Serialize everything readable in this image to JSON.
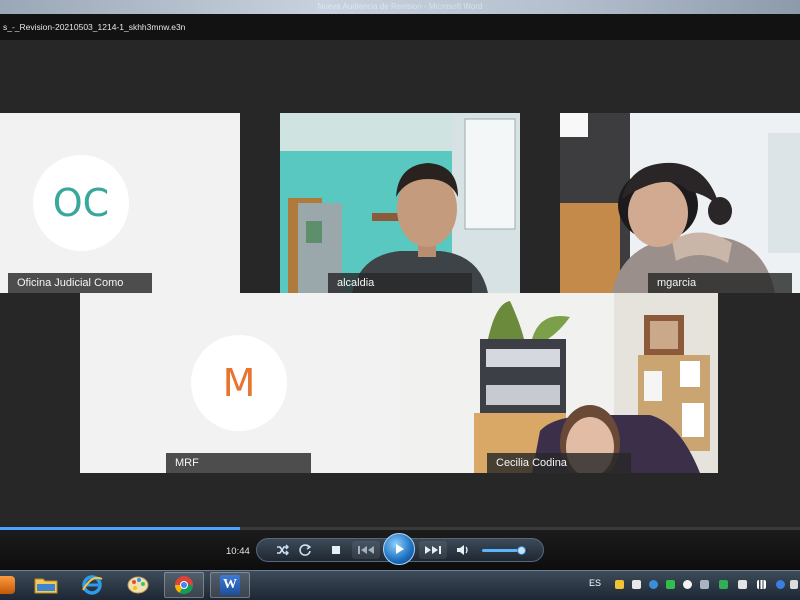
{
  "window": {
    "title": "Nueva Audiencia de Revision - Microsoft Word",
    "file_name": "s_-_Revision-20210503_1214-1_skhh3mnw.e3n"
  },
  "participants": [
    {
      "name": "Oficina Judicial Como",
      "initials": "OC",
      "initials_color": "#3aa79d",
      "type": "avatar"
    },
    {
      "name": "alcaldia",
      "type": "video"
    },
    {
      "name": "mgarcia",
      "type": "video"
    },
    {
      "name": "MRF",
      "initials": "M",
      "initials_color": "#e8752f",
      "type": "avatar"
    },
    {
      "name": "Cecilia Codina",
      "type": "video"
    }
  ],
  "player": {
    "time": "10:44",
    "progress": 0.3,
    "volume": 0.85,
    "icons": [
      "shuffle-icon",
      "repeat-icon",
      "stop-icon",
      "previous-icon",
      "play-icon",
      "next-icon",
      "volume-icon"
    ]
  },
  "taskbar": {
    "apps": [
      "media-player-icon",
      "folder-icon",
      "internet-explorer-icon",
      "paint-icon",
      "chrome-icon",
      "word-icon"
    ],
    "word_label": "W",
    "language": "ES"
  }
}
